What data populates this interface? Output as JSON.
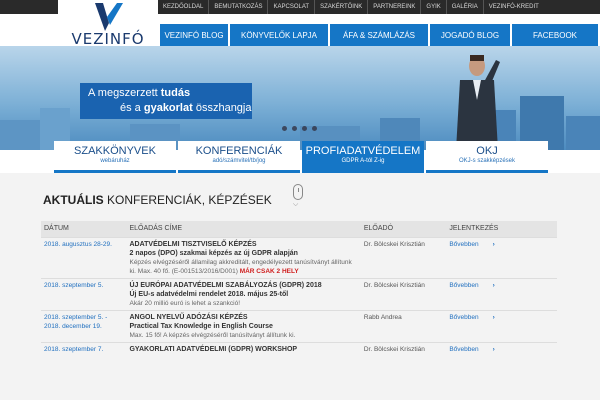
{
  "top_links": [
    "KEZDŐOLDAL",
    "BEMUTATKOZÁS",
    "KAPCSOLAT",
    "SZAKÉRTŐINK",
    "PARTNEREINK",
    "GYIK",
    "GALÉRIA",
    "VEZINFÓ-KREDIT"
  ],
  "logo": {
    "text": "VEZINFÓ"
  },
  "main_nav": [
    "VEZINFÓ BLOG",
    "KÖNYVELŐK LAPJA",
    "ÁFA & SZÁMLÁZÁS",
    "JOGADÓ BLOG",
    "FACEBOOK"
  ],
  "hero": {
    "line1_prefix": "A megszerzett ",
    "line1_bold": "tudás",
    "line2_prefix": "és a ",
    "line2_bold": "gyakorlat",
    "line2_suffix": " összhangja",
    "slide_count": 4
  },
  "tabs": [
    {
      "title": "SZAKKÖNYVEK",
      "sub": "webáruház",
      "active": false
    },
    {
      "title": "KONFERENCIÁK",
      "sub": "adó/számvitel/tb/jog",
      "active": false
    },
    {
      "title": "PROFIADATVÉDELEM",
      "sub": "GDPR A-tól Z-ig",
      "active": true
    },
    {
      "title": "OKJ",
      "sub": "OKJ-s szakképzések",
      "active": false
    }
  ],
  "section": {
    "title_bold": "AKTUÁLIS",
    "title_rest": " KONFERENCIÁK, KÉPZÉSEK"
  },
  "table": {
    "headers": [
      "DÁTUM",
      "ELŐADÁS CÍME",
      "ELŐADÓ",
      "JELENTKEZÉS"
    ],
    "rows": [
      {
        "date": "2018. augusztus 28-29.",
        "title": "ADATVÉDELMI TISZTVISELŐ KÉPZÉS",
        "subtitle": "2 napos (DPO) szakmai képzés az új GDPR alapján",
        "desc": "Képzés elvégzéséről államilag akkreditált, engedélyezett tanúsítványt állítunk ki. Max. 40 fő. (E-001513/2016/D001)",
        "warn": "MÁR CSAK 2 HELY",
        "presenter": "Dr. Bölcskei Krisztián",
        "more": "Bővebben"
      },
      {
        "date": "2018. szeptember 5.",
        "title": "ÚJ EURÓPAI ADATVÉDELMI SZABÁLYOZÁS (GDPR) 2018",
        "subtitle": "Új EU-s adatvédelmi rendelet 2018. május 25-től",
        "desc": "Akár 20 millió euró is lehet a szankció!",
        "warn": "",
        "presenter": "Dr. Bölcskei Krisztián",
        "more": "Bővebben"
      },
      {
        "date": "2018. szeptember 5. - 2018. december 19.",
        "title": "ANGOL NYELVŰ ADÓZÁSI KÉPZÉS",
        "subtitle": "Practical Tax Knowledge in English Course",
        "desc": "Max. 15 fő! A képzés elvégzéséről tanúsítványt állítunk ki.",
        "warn": "",
        "presenter": "Rabb Andrea",
        "more": "Bővebben"
      },
      {
        "date": "2018. szeptember 7.",
        "title": "GYAKORLATI ADATVÉDELMI (GDPR) WORKSHOP",
        "subtitle": "",
        "desc": "",
        "warn": "",
        "presenter": "Dr. Bölcskei Krisztián",
        "more": "Bővebben"
      }
    ]
  },
  "colors": {
    "brand_blue": "#1576c6",
    "top_bar": "#2a2a2a",
    "warn_red": "#d02020"
  }
}
